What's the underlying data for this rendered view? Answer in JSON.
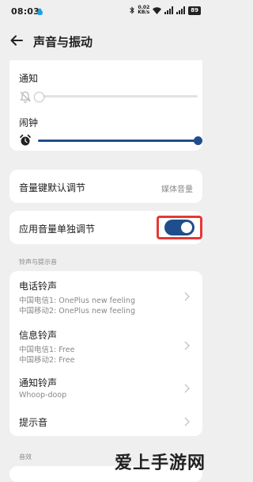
{
  "status_bar": {
    "time": "08:03",
    "net_speed": "0.02",
    "net_unit": "KB/s",
    "battery": "89"
  },
  "header": {
    "title": "声音与振动"
  },
  "sliders": [
    {
      "label": "通知",
      "icon": "mute-bell-icon",
      "level": 0.0
    },
    {
      "label": "闹钟",
      "icon": "alarm-clock-icon",
      "level": 1.0
    }
  ],
  "volume_key": {
    "label": "音量键默认调节",
    "value": "媒体音量"
  },
  "app_volume": {
    "label": "应用音量单独调节",
    "enabled": true
  },
  "ringtones": {
    "section_label": "铃声与提示音",
    "phone": {
      "label": "电话铃声",
      "sim1": "中国电信1: OnePlus new feeling",
      "sim2": "中国移动2: OnePlus new feeling"
    },
    "message": {
      "label": "信息铃声",
      "sim1": "中国电信1: Free",
      "sim2": "中国移动2: Free"
    },
    "notification": {
      "label": "通知铃声",
      "value": "Whoop-doop"
    },
    "system": {
      "label": "提示音"
    }
  },
  "effects": {
    "section_label": "音效"
  },
  "watermark": "爱上手游网",
  "colors": {
    "accent": "#1f4e8c",
    "highlight": "#e53935",
    "background": "#efefef"
  }
}
